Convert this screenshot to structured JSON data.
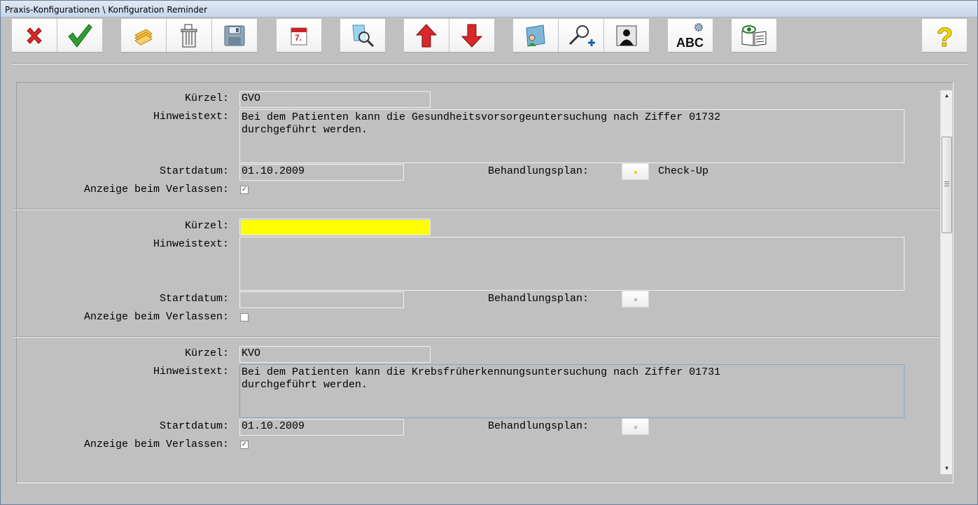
{
  "window": {
    "title": "Praxis-Konfigurationen \\ Konfiguration Reminder"
  },
  "toolbar": [
    {
      "name": "cancel-button",
      "icon": "red-x-icon"
    },
    {
      "name": "ok-button",
      "icon": "green-check-icon"
    },
    {
      "name": "new-button",
      "icon": "folders-icon"
    },
    {
      "name": "delete-button",
      "icon": "trash-icon"
    },
    {
      "name": "save-button",
      "icon": "floppy-disk-icon"
    },
    {
      "name": "calendar-button",
      "icon": "calendar-icon",
      "text": "7."
    },
    {
      "name": "search-button",
      "icon": "document-magnifier-icon"
    },
    {
      "name": "move-up-button",
      "icon": "red-arrow-up-icon"
    },
    {
      "name": "move-down-button",
      "icon": "red-arrow-down-icon"
    },
    {
      "name": "patient-book-button",
      "icon": "person-book-icon"
    },
    {
      "name": "search-add-button",
      "icon": "magnifier-plus-icon"
    },
    {
      "name": "patient-button",
      "icon": "person-silhouette-icon"
    },
    {
      "name": "spellcheck-button",
      "icon": "abc-gear-icon",
      "text": "ABC"
    },
    {
      "name": "preview-button",
      "icon": "eye-book-icon"
    },
    {
      "name": "help-button",
      "icon": "question-mark-icon",
      "text": "?"
    }
  ],
  "labels": {
    "kuerzel": "Kürzel:",
    "hinweistext": "Hinweistext:",
    "startdatum": "Startdatum:",
    "behandlungsplan": "Behandlungsplan:",
    "anzeige": "Anzeige beim Verlassen:"
  },
  "reminders": [
    {
      "kuerzel": "GVO",
      "hinweistext_line1": "Bei dem Patienten kann die Gesundheitsvorsorgeuntersuchung nach Ziffer 01732",
      "hinweistext_line2": "durchgeführt werden.",
      "startdatum": "01.10.2009",
      "behandlungsplan": "Check-Up",
      "anzeige_checked": "✓"
    },
    {
      "kuerzel": "",
      "hinweistext_line1": "",
      "hinweistext_line2": "",
      "startdatum": "",
      "behandlungsplan": "",
      "anzeige_checked": ""
    },
    {
      "kuerzel": "KVO",
      "hinweistext_line1": "Bei dem Patienten kann die Krebsfrüherkennungsuntersuchung nach Ziffer 01731",
      "hinweistext_line2": "durchgeführt werden.",
      "startdatum": "01.10.2009",
      "behandlungsplan": "",
      "anzeige_checked": "✓"
    }
  ],
  "colors": {
    "background": "#c0c0c0",
    "highlight": "#ffff00",
    "accent_red": "#d8282a",
    "accent_green": "#2e9e2e"
  }
}
